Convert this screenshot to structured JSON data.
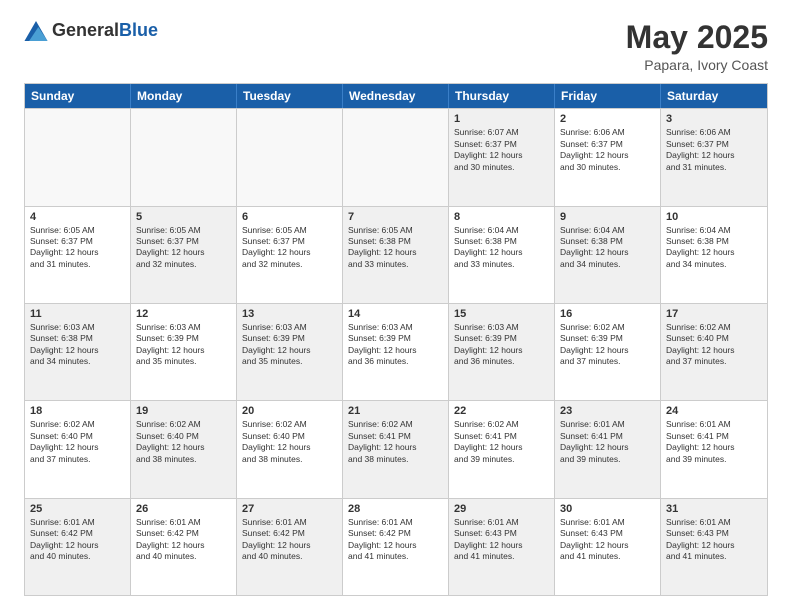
{
  "logo": {
    "general": "General",
    "blue": "Blue"
  },
  "title": "May 2025",
  "subtitle": "Papara, Ivory Coast",
  "header_days": [
    "Sunday",
    "Monday",
    "Tuesday",
    "Wednesday",
    "Thursday",
    "Friday",
    "Saturday"
  ],
  "weeks": [
    [
      {
        "day": "",
        "info": "",
        "empty": true
      },
      {
        "day": "",
        "info": "",
        "empty": true
      },
      {
        "day": "",
        "info": "",
        "empty": true
      },
      {
        "day": "",
        "info": "",
        "empty": true
      },
      {
        "day": "1",
        "info": "Sunrise: 6:07 AM\nSunset: 6:37 PM\nDaylight: 12 hours\nand 30 minutes."
      },
      {
        "day": "2",
        "info": "Sunrise: 6:06 AM\nSunset: 6:37 PM\nDaylight: 12 hours\nand 30 minutes."
      },
      {
        "day": "3",
        "info": "Sunrise: 6:06 AM\nSunset: 6:37 PM\nDaylight: 12 hours\nand 31 minutes."
      }
    ],
    [
      {
        "day": "4",
        "info": "Sunrise: 6:05 AM\nSunset: 6:37 PM\nDaylight: 12 hours\nand 31 minutes."
      },
      {
        "day": "5",
        "info": "Sunrise: 6:05 AM\nSunset: 6:37 PM\nDaylight: 12 hours\nand 32 minutes."
      },
      {
        "day": "6",
        "info": "Sunrise: 6:05 AM\nSunset: 6:37 PM\nDaylight: 12 hours\nand 32 minutes."
      },
      {
        "day": "7",
        "info": "Sunrise: 6:05 AM\nSunset: 6:38 PM\nDaylight: 12 hours\nand 33 minutes."
      },
      {
        "day": "8",
        "info": "Sunrise: 6:04 AM\nSunset: 6:38 PM\nDaylight: 12 hours\nand 33 minutes."
      },
      {
        "day": "9",
        "info": "Sunrise: 6:04 AM\nSunset: 6:38 PM\nDaylight: 12 hours\nand 34 minutes."
      },
      {
        "day": "10",
        "info": "Sunrise: 6:04 AM\nSunset: 6:38 PM\nDaylight: 12 hours\nand 34 minutes."
      }
    ],
    [
      {
        "day": "11",
        "info": "Sunrise: 6:03 AM\nSunset: 6:38 PM\nDaylight: 12 hours\nand 34 minutes."
      },
      {
        "day": "12",
        "info": "Sunrise: 6:03 AM\nSunset: 6:39 PM\nDaylight: 12 hours\nand 35 minutes."
      },
      {
        "day": "13",
        "info": "Sunrise: 6:03 AM\nSunset: 6:39 PM\nDaylight: 12 hours\nand 35 minutes."
      },
      {
        "day": "14",
        "info": "Sunrise: 6:03 AM\nSunset: 6:39 PM\nDaylight: 12 hours\nand 36 minutes."
      },
      {
        "day": "15",
        "info": "Sunrise: 6:03 AM\nSunset: 6:39 PM\nDaylight: 12 hours\nand 36 minutes."
      },
      {
        "day": "16",
        "info": "Sunrise: 6:02 AM\nSunset: 6:39 PM\nDaylight: 12 hours\nand 37 minutes."
      },
      {
        "day": "17",
        "info": "Sunrise: 6:02 AM\nSunset: 6:40 PM\nDaylight: 12 hours\nand 37 minutes."
      }
    ],
    [
      {
        "day": "18",
        "info": "Sunrise: 6:02 AM\nSunset: 6:40 PM\nDaylight: 12 hours\nand 37 minutes."
      },
      {
        "day": "19",
        "info": "Sunrise: 6:02 AM\nSunset: 6:40 PM\nDaylight: 12 hours\nand 38 minutes."
      },
      {
        "day": "20",
        "info": "Sunrise: 6:02 AM\nSunset: 6:40 PM\nDaylight: 12 hours\nand 38 minutes."
      },
      {
        "day": "21",
        "info": "Sunrise: 6:02 AM\nSunset: 6:41 PM\nDaylight: 12 hours\nand 38 minutes."
      },
      {
        "day": "22",
        "info": "Sunrise: 6:02 AM\nSunset: 6:41 PM\nDaylight: 12 hours\nand 39 minutes."
      },
      {
        "day": "23",
        "info": "Sunrise: 6:01 AM\nSunset: 6:41 PM\nDaylight: 12 hours\nand 39 minutes."
      },
      {
        "day": "24",
        "info": "Sunrise: 6:01 AM\nSunset: 6:41 PM\nDaylight: 12 hours\nand 39 minutes."
      }
    ],
    [
      {
        "day": "25",
        "info": "Sunrise: 6:01 AM\nSunset: 6:42 PM\nDaylight: 12 hours\nand 40 minutes."
      },
      {
        "day": "26",
        "info": "Sunrise: 6:01 AM\nSunset: 6:42 PM\nDaylight: 12 hours\nand 40 minutes."
      },
      {
        "day": "27",
        "info": "Sunrise: 6:01 AM\nSunset: 6:42 PM\nDaylight: 12 hours\nand 40 minutes."
      },
      {
        "day": "28",
        "info": "Sunrise: 6:01 AM\nSunset: 6:42 PM\nDaylight: 12 hours\nand 41 minutes."
      },
      {
        "day": "29",
        "info": "Sunrise: 6:01 AM\nSunset: 6:43 PM\nDaylight: 12 hours\nand 41 minutes."
      },
      {
        "day": "30",
        "info": "Sunrise: 6:01 AM\nSunset: 6:43 PM\nDaylight: 12 hours\nand 41 minutes."
      },
      {
        "day": "31",
        "info": "Sunrise: 6:01 AM\nSunset: 6:43 PM\nDaylight: 12 hours\nand 41 minutes."
      }
    ]
  ]
}
